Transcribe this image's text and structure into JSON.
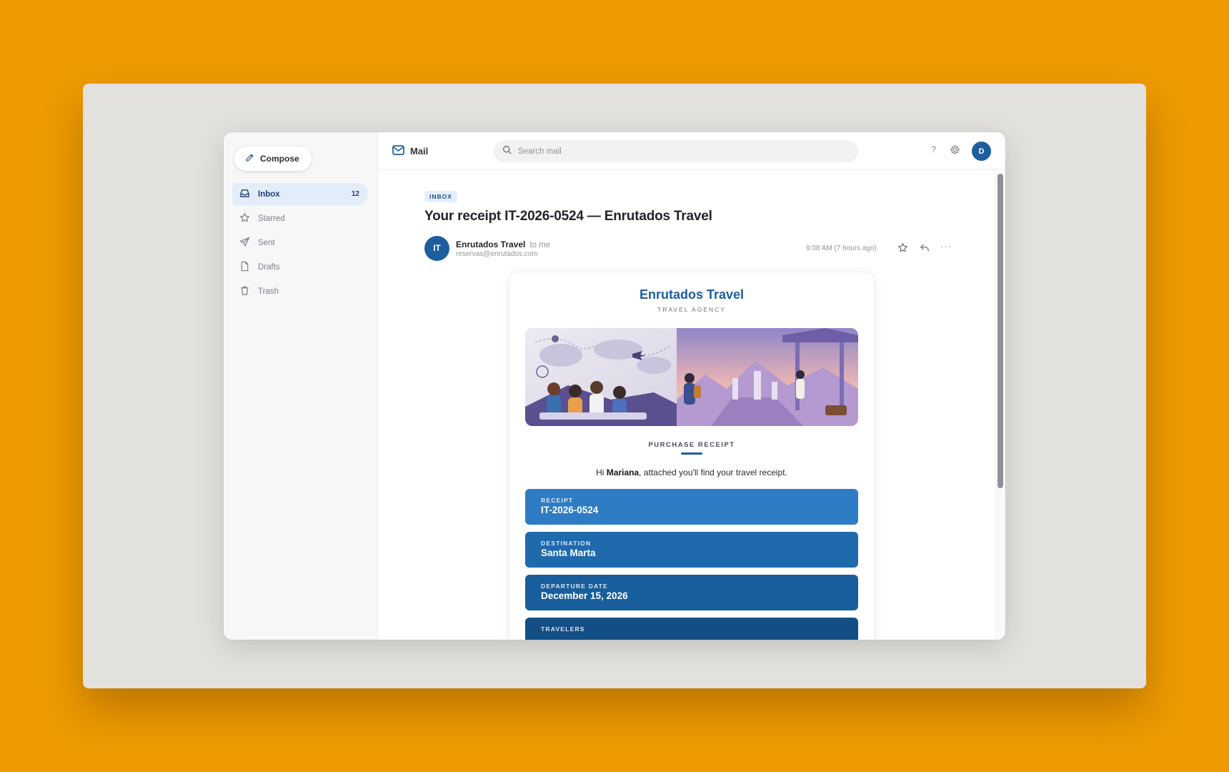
{
  "sidebar": {
    "compose_label": "Compose",
    "items": [
      {
        "label": "Inbox",
        "count": "12",
        "icon": "inbox-icon"
      },
      {
        "label": "Starred",
        "icon": "star-icon"
      },
      {
        "label": "Sent",
        "icon": "send-icon"
      },
      {
        "label": "Drafts",
        "icon": "file-icon"
      },
      {
        "label": "Trash",
        "icon": "trash-icon"
      }
    ]
  },
  "topbar": {
    "app_name": "Mail",
    "search_placeholder": "Search mail",
    "help_label": "?",
    "avatar_initial": "D"
  },
  "message": {
    "folder_tag": "INBOX",
    "subject": "Your receipt IT-2026-0524 — Enrutados Travel",
    "sender_initials": "IT",
    "sender_name": "Enrutados Travel",
    "recipient": "to me",
    "sender_email": "reservas@enrutados.com",
    "time": "9:08 AM (7 hours ago)",
    "more_label": "···"
  },
  "receipt": {
    "brand": "Enrutados Travel",
    "brand_sub": "TRAVEL AGENCY",
    "section_label": "PURCHASE RECEIPT",
    "greeting_prefix": "Hi ",
    "greeting_name": "Mariana",
    "greeting_suffix": ", attached you'll find your travel receipt.",
    "fields": [
      {
        "label": "RECEIPT",
        "value": "IT-2026-0524",
        "color": "#2e7cc4"
      },
      {
        "label": "DESTINATION",
        "value": "Santa Marta",
        "color": "#1f6aad"
      },
      {
        "label": "DEPARTURE DATE",
        "value": "December 15, 2026",
        "color": "#195e9c"
      },
      {
        "label": "TRAVELERS",
        "value": "",
        "color": "#134e85"
      }
    ]
  },
  "colors": {
    "accent": "#1d5e9f",
    "background": "#ef9b00"
  }
}
